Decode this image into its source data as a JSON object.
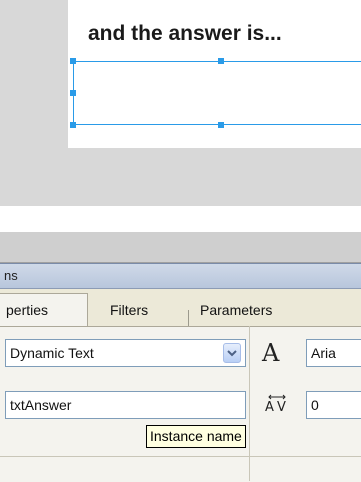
{
  "stage": {
    "prompt_text": "and the answer is..."
  },
  "panel": {
    "title_fragment": "ns",
    "tabs": [
      {
        "label": "perties",
        "active": true
      },
      {
        "label": "Filters",
        "active": false
      },
      {
        "label": "Parameters",
        "active": false
      }
    ],
    "text_type_select": "Dynamic Text",
    "font_field": "Aria",
    "instance_name": "txtAnswer",
    "letter_spacing": "0",
    "tooltip": "Instance name"
  },
  "colors": {
    "selection": "#2a9be8",
    "panel_bg": "#f4f3ee",
    "tab_bg": "#ece9d8"
  }
}
